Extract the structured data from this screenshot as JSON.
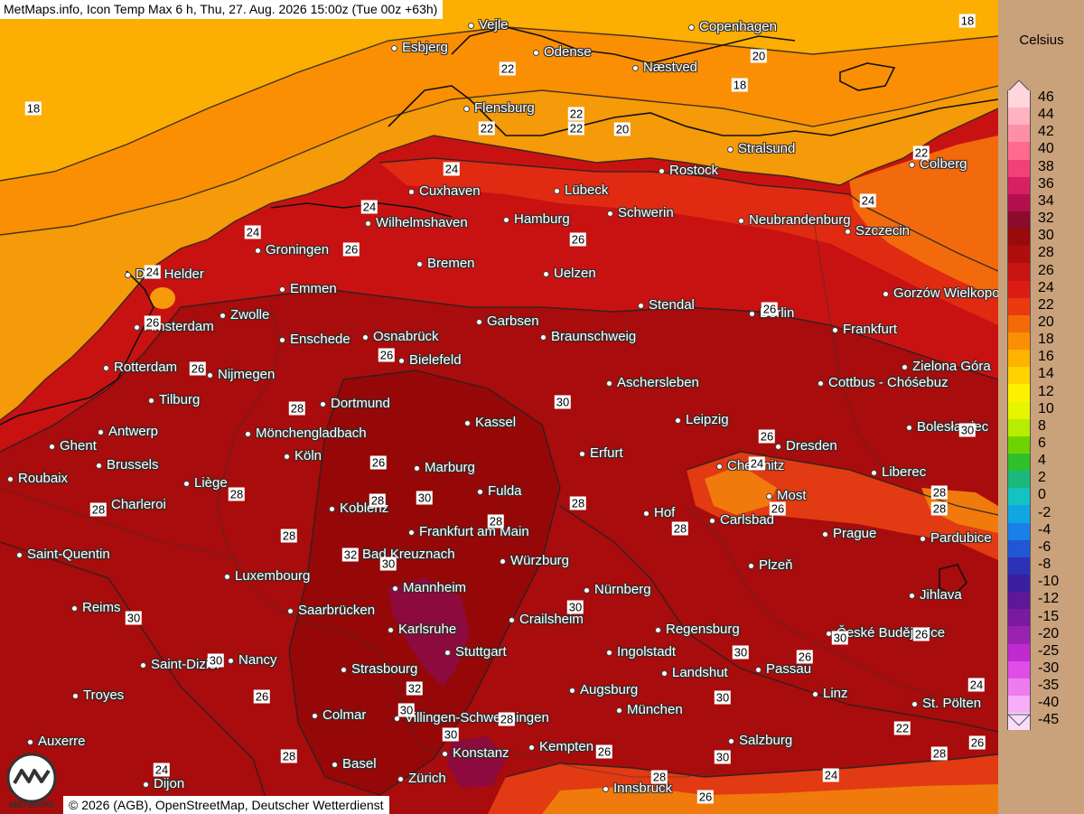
{
  "title": "MetMaps.info, Icon Temp Max 6 h, Thu, 27. Aug. 2026 15:00z (Tue 00z +63h)",
  "credit": "© 2026 (AGB), OpenStreetMap, Deutscher Wetterdienst",
  "logo_text": "METMAPS",
  "legend": {
    "unit": "Celsius",
    "ticks": [
      "46",
      "44",
      "42",
      "40",
      "38",
      "36",
      "34",
      "32",
      "30",
      "28",
      "26",
      "24",
      "22",
      "20",
      "18",
      "16",
      "14",
      "12",
      "10",
      "8",
      "6",
      "4",
      "2",
      "0",
      "-2",
      "-4",
      "-6",
      "-8",
      "-10",
      "-12",
      "-15",
      "-20",
      "-25",
      "-30",
      "-35",
      "-40",
      "-45"
    ],
    "colors": [
      "#ffd6dc",
      "#ffb3c0",
      "#ff8fa8",
      "#ff6a8e",
      "#f2407a",
      "#d81f62",
      "#b30f4e",
      "#8c0a2a",
      "#9a0a0a",
      "#b00e0e",
      "#c91414",
      "#dc1c14",
      "#ec3a10",
      "#f56a08",
      "#fb8f04",
      "#fdb300",
      "#ffd200",
      "#fff200",
      "#e6f500",
      "#b8ec00",
      "#6ed400",
      "#2fc02a",
      "#1ab87a",
      "#13c2c2",
      "#12a6e0",
      "#1a7fe8",
      "#2156d6",
      "#2b32b8",
      "#3a1fa0",
      "#5c1896",
      "#7a1a9e",
      "#9a22b2",
      "#c02ad0",
      "#e04ce6",
      "#ef7cef",
      "#f7aef7",
      "#fcdcfc"
    ]
  },
  "cities": [
    {
      "name": "Vejle"
    },
    {
      "name": "Copenhagen"
    },
    {
      "name": "Esbjerg"
    },
    {
      "name": "Odense"
    },
    {
      "name": "Næstved"
    },
    {
      "name": "Flensburg"
    },
    {
      "name": "Stralsund"
    },
    {
      "name": "Rostock"
    },
    {
      "name": "Colberg"
    },
    {
      "name": "Cuxhaven"
    },
    {
      "name": "Lübeck"
    },
    {
      "name": "Wilhelmshaven"
    },
    {
      "name": "Hamburg"
    },
    {
      "name": "Schwerin"
    },
    {
      "name": "Neubrandenburg"
    },
    {
      "name": "Szczecin"
    },
    {
      "name": "Groningen"
    },
    {
      "name": "Bremen"
    },
    {
      "name": "Den Helder"
    },
    {
      "name": "Uelzen"
    },
    {
      "name": "Emmen"
    },
    {
      "name": "Gorzów Wielkopolski"
    },
    {
      "name": "Stendal"
    },
    {
      "name": "Berlin"
    },
    {
      "name": "Zwolle"
    },
    {
      "name": "Garbsen"
    },
    {
      "name": "Amsterdam"
    },
    {
      "name": "Osnabrück"
    },
    {
      "name": "Frankfurt"
    },
    {
      "name": "Enschede"
    },
    {
      "name": "Braunschweig"
    },
    {
      "name": "Bielefeld"
    },
    {
      "name": "Rotterdam"
    },
    {
      "name": "Zielona Góra"
    },
    {
      "name": "Nijmegen"
    },
    {
      "name": "Aschersleben"
    },
    {
      "name": "Cottbus - Chóśebuz"
    },
    {
      "name": "Tilburg"
    },
    {
      "name": "Dortmund"
    },
    {
      "name": "Kassel"
    },
    {
      "name": "Leipzig"
    },
    {
      "name": "Antwerp"
    },
    {
      "name": "Mönchengladbach"
    },
    {
      "name": "Bolesławiec"
    },
    {
      "name": "Dresden"
    },
    {
      "name": "Ghent"
    },
    {
      "name": "Köln"
    },
    {
      "name": "Erfurt"
    },
    {
      "name": "Brussels"
    },
    {
      "name": "Marburg"
    },
    {
      "name": "Chemnitz"
    },
    {
      "name": "Liberec"
    },
    {
      "name": "Roubaix"
    },
    {
      "name": "Liège"
    },
    {
      "name": "Fulda"
    },
    {
      "name": "Most"
    },
    {
      "name": "Charleroi"
    },
    {
      "name": "Koblenz"
    },
    {
      "name": "Hof"
    },
    {
      "name": "Carlsbad"
    },
    {
      "name": "Frankfurt am Main"
    },
    {
      "name": "Prague"
    },
    {
      "name": "Pardubice"
    },
    {
      "name": "Saint-Quentin"
    },
    {
      "name": "Bad Kreuznach"
    },
    {
      "name": "Würzburg"
    },
    {
      "name": "Plzeň"
    },
    {
      "name": "Luxembourg"
    },
    {
      "name": "Mannheim"
    },
    {
      "name": "Nürnberg"
    },
    {
      "name": "Jihlava"
    },
    {
      "name": "Reims"
    },
    {
      "name": "Saarbrücken"
    },
    {
      "name": "Crailsheim"
    },
    {
      "name": "Karlsruhe"
    },
    {
      "name": "Regensburg"
    },
    {
      "name": "České Budějovice"
    },
    {
      "name": "Stuttgart"
    },
    {
      "name": "Ingolstadt"
    },
    {
      "name": "Saint-Dizier"
    },
    {
      "name": "Nancy"
    },
    {
      "name": "Strasbourg"
    },
    {
      "name": "Landshut"
    },
    {
      "name": "Passau"
    },
    {
      "name": "Troyes"
    },
    {
      "name": "Augsburg"
    },
    {
      "name": "Linz"
    },
    {
      "name": "St. Pölten"
    },
    {
      "name": "Colmar"
    },
    {
      "name": "Villingen-Schwenningen"
    },
    {
      "name": "München"
    },
    {
      "name": "Auxerre"
    },
    {
      "name": "Salzburg"
    },
    {
      "name": "Konstanz"
    },
    {
      "name": "Kempten"
    },
    {
      "name": "Basel"
    },
    {
      "name": "Zürich"
    },
    {
      "name": "Innsbruck"
    },
    {
      "name": "Dijon"
    }
  ],
  "temp_labels": [
    "18",
    "18",
    "22",
    "18",
    "20",
    "20",
    "22",
    "22",
    "22",
    "24",
    "22",
    "24",
    "24",
    "26",
    "26",
    "24",
    "24",
    "26",
    "26",
    "28",
    "30",
    "26",
    "26",
    "26",
    "24",
    "28",
    "30",
    "28",
    "28",
    "28",
    "26",
    "28",
    "28",
    "30",
    "32",
    "30",
    "28",
    "30",
    "28",
    "28",
    "26",
    "30",
    "30",
    "32",
    "30",
    "30",
    "28",
    "26",
    "30",
    "26",
    "30",
    "30",
    "26",
    "30",
    "28",
    "24",
    "26",
    "24",
    "22",
    "28",
    "26",
    "28",
    "26",
    "24"
  ]
}
